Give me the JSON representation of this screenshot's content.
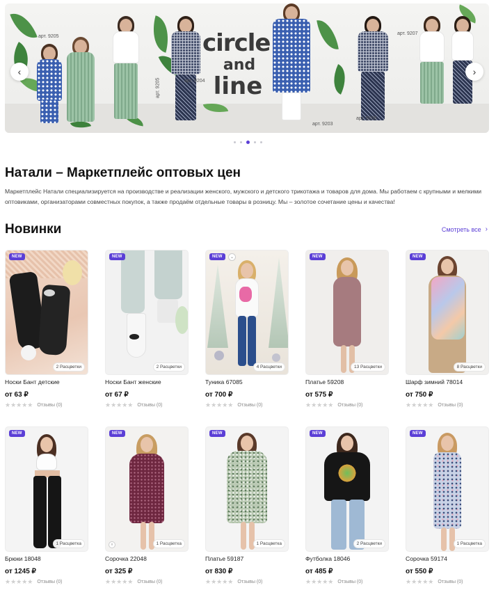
{
  "banner": {
    "brand_word1": "circle",
    "brand_word2": "and",
    "brand_word3": "line",
    "art_labels": [
      "арт. 9205",
      "арт. 9205",
      "арт. 9204",
      "арт. 9203",
      "арт. 9206",
      "арт. 9207"
    ],
    "prev_icon": "‹",
    "next_icon": "›",
    "slides_count": 5,
    "active_slide": 3
  },
  "intro": {
    "title": "Натали – Маркетплейс оптовых цен",
    "text": "Маркетплейс Натали специализируется на производстве и реализации женского, мужского и детского трикотажа и товаров для дома. Мы работаем с крупными и мелкими оптовиками, организаторами совместных покупок, а также продаём отдельные товары в розницу. Мы – золотое сочетание цены и качества!"
  },
  "new_section": {
    "title": "Новинки",
    "see_all": "Смотреть все",
    "badge": "NEW",
    "reviews_label": "Отзывы (0)",
    "products": [
      {
        "name": "Носки Бант детские",
        "price": "от 63 ₽",
        "colors": "2 Расцветки"
      },
      {
        "name": "Носки Бант женские",
        "price": "от 67 ₽",
        "colors": "2 Расцветки"
      },
      {
        "name": "Туника 67085",
        "price": "от 700 ₽",
        "colors": "4 Расцветки"
      },
      {
        "name": "Платье 59208",
        "price": "от 575 ₽",
        "colors": "13 Расцветки"
      },
      {
        "name": "Шарф зимний 78014",
        "price": "от 750 ₽",
        "colors": "8 Расцветки"
      },
      {
        "name": "Брюки 18048",
        "price": "от 1245 ₽",
        "colors": "1 Расцветка"
      },
      {
        "name": "Сорочка 22048",
        "price": "от 325 ₽",
        "colors": "1 Расцветка"
      },
      {
        "name": "Платье 59187",
        "price": "от 830 ₽",
        "colors": "1 Расцветка"
      },
      {
        "name": "Футболка 18046",
        "price": "от 485 ₽",
        "colors": "2 Расцветки"
      },
      {
        "name": "Сорочка 59174",
        "price": "от 550 ₽",
        "colors": "1 Расцветка"
      }
    ]
  },
  "colors": {
    "accent": "#5b3fd6",
    "text": "#1a1a1a",
    "muted": "#888888"
  }
}
